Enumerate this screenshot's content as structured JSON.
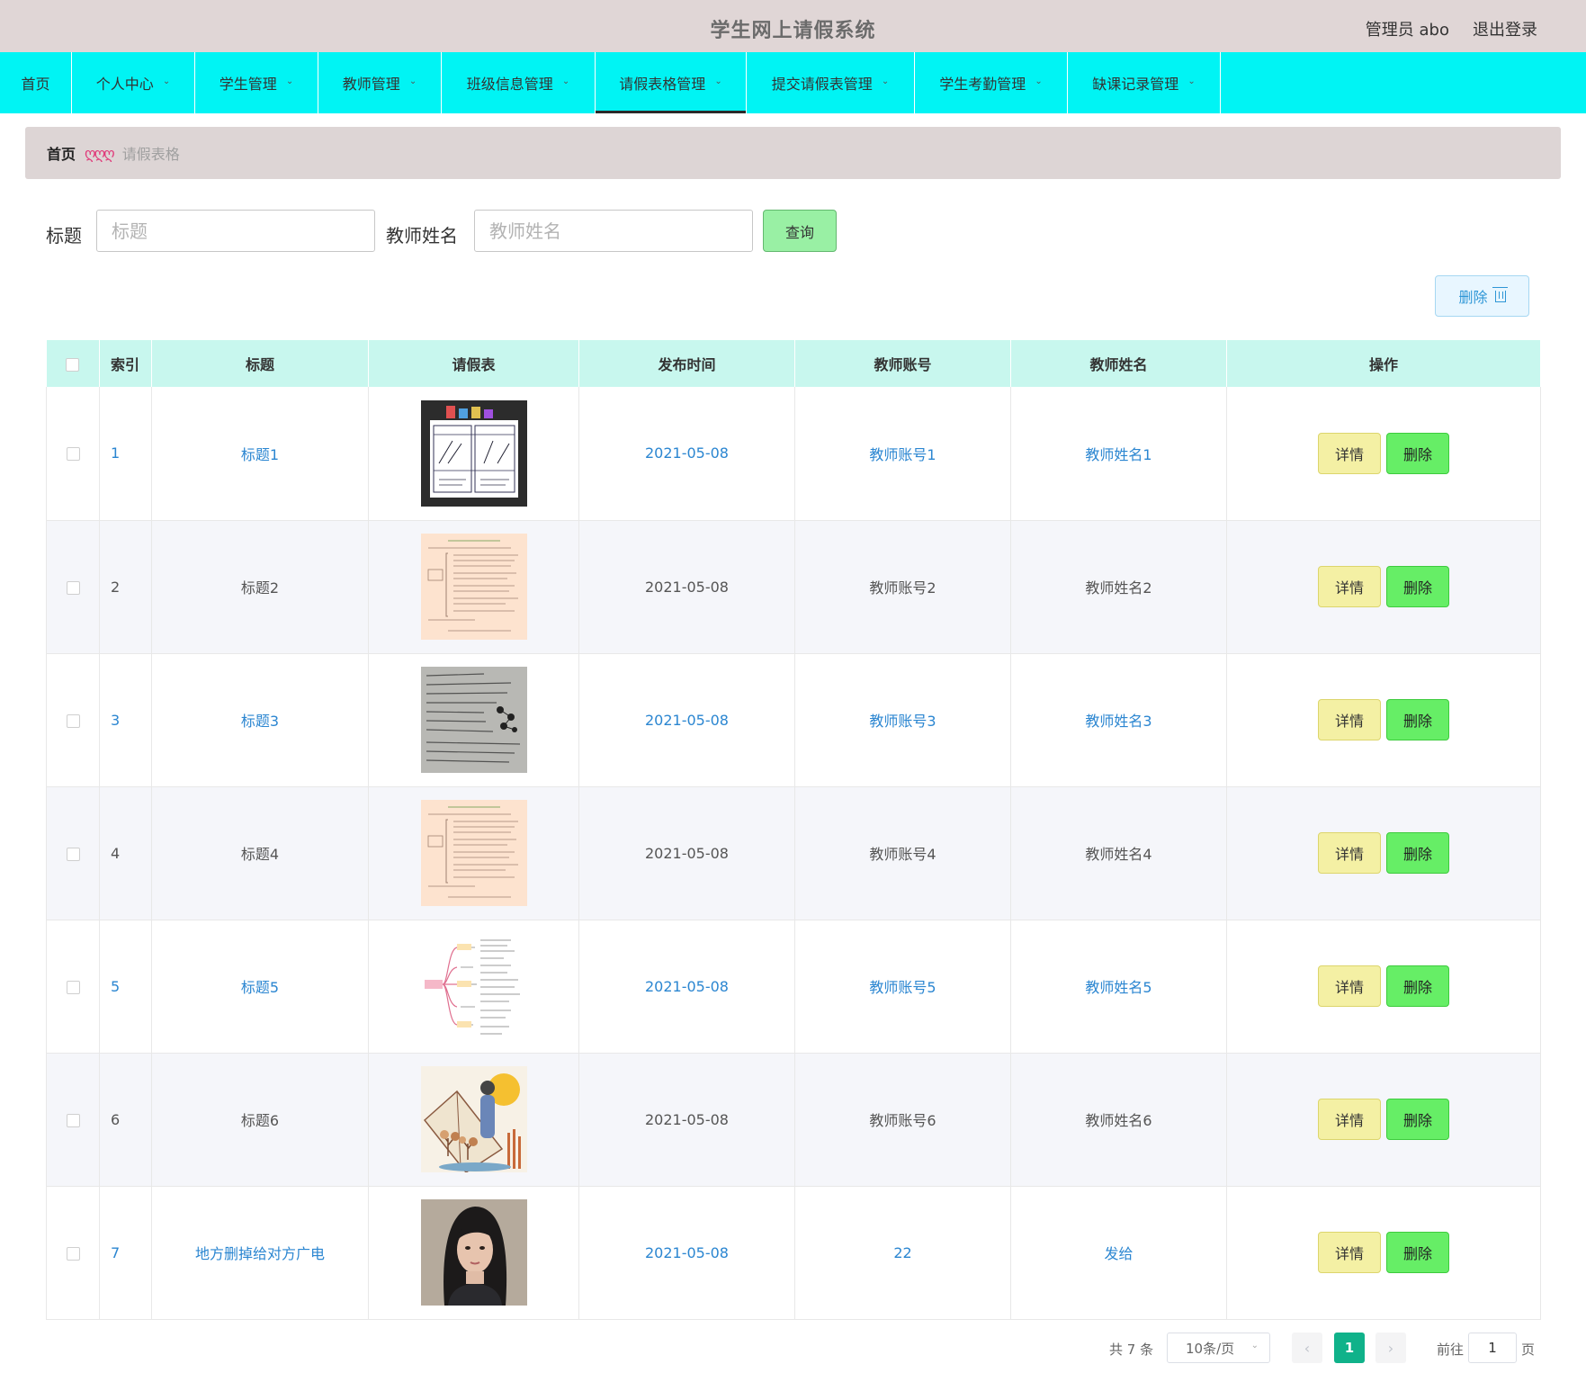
{
  "header": {
    "title": "学生网上请假系统",
    "user": "管理员 abo",
    "logout": "退出登录"
  },
  "nav": {
    "items": [
      {
        "label": "首页",
        "has_menu": false,
        "active": false
      },
      {
        "label": "个人中心",
        "has_menu": true,
        "active": false
      },
      {
        "label": "学生管理",
        "has_menu": true,
        "active": false
      },
      {
        "label": "教师管理",
        "has_menu": true,
        "active": false
      },
      {
        "label": "班级信息管理",
        "has_menu": true,
        "active": false
      },
      {
        "label": "请假表格管理",
        "has_menu": true,
        "active": true
      },
      {
        "label": "提交请假表管理",
        "has_menu": true,
        "active": false
      },
      {
        "label": "学生考勤管理",
        "has_menu": true,
        "active": false
      },
      {
        "label": "缺课记录管理",
        "has_menu": true,
        "active": false
      }
    ]
  },
  "breadcrumb": {
    "home": "首页",
    "separator": "ღღღ",
    "current": "请假表格"
  },
  "search": {
    "title_label": "标题",
    "title_placeholder": "标题",
    "teacher_label": "教师姓名",
    "teacher_placeholder": "教师姓名",
    "query_button": "查询"
  },
  "toolbar": {
    "delete_label": "删除"
  },
  "table": {
    "columns": [
      "索引",
      "标题",
      "请假表",
      "发布时间",
      "教师账号",
      "教师姓名",
      "操作"
    ],
    "detail_label": "详情",
    "delete_label": "删除",
    "rows": [
      {
        "index": "1",
        "title": "标题1",
        "image": "math-chart",
        "date": "2021-05-08",
        "account": "教师账号1",
        "name": "教师姓名1"
      },
      {
        "index": "2",
        "title": "标题2",
        "image": "document-peach",
        "date": "2021-05-08",
        "account": "教师账号2",
        "name": "教师姓名2"
      },
      {
        "index": "3",
        "title": "标题3",
        "image": "document-gray",
        "date": "2021-05-08",
        "account": "教师账号3",
        "name": "教师姓名3"
      },
      {
        "index": "4",
        "title": "标题4",
        "image": "document-peach",
        "date": "2021-05-08",
        "account": "教师账号4",
        "name": "教师姓名4"
      },
      {
        "index": "5",
        "title": "标题5",
        "image": "mind-map",
        "date": "2021-05-08",
        "account": "教师账号5",
        "name": "教师姓名5"
      },
      {
        "index": "6",
        "title": "标题6",
        "image": "illustration",
        "date": "2021-05-08",
        "account": "教师账号6",
        "name": "教师姓名6"
      },
      {
        "index": "7",
        "title": "地方删掉给对方广电",
        "image": "portrait",
        "date": "2021-05-08",
        "account": "22",
        "name": "发给"
      }
    ]
  },
  "pagination": {
    "total": "共 7 条",
    "page_size": "10条/页",
    "current_page": "1",
    "goto_label": "前往",
    "goto_value": "1",
    "page_suffix": "页"
  },
  "colors": {
    "nav_bg": "#00f4f4",
    "header_bg": "#e0d6d6",
    "table_header_bg": "#c8f7ee",
    "link": "#2b86d1",
    "pager_active": "#10b28a"
  }
}
